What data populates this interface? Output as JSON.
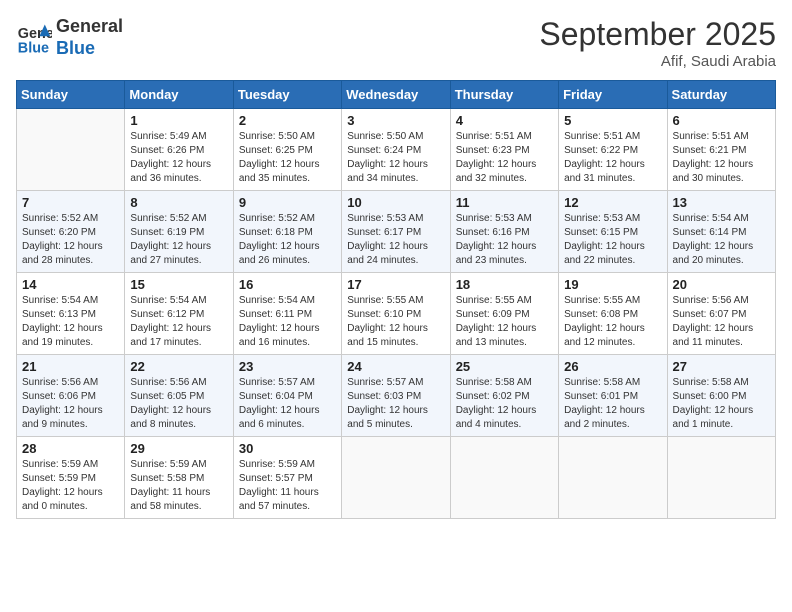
{
  "header": {
    "logo_line1": "General",
    "logo_line2": "Blue",
    "month": "September 2025",
    "location": "Afif, Saudi Arabia"
  },
  "days_of_week": [
    "Sunday",
    "Monday",
    "Tuesday",
    "Wednesday",
    "Thursday",
    "Friday",
    "Saturday"
  ],
  "weeks": [
    [
      {
        "day": "",
        "info": ""
      },
      {
        "day": "1",
        "info": "Sunrise: 5:49 AM\nSunset: 6:26 PM\nDaylight: 12 hours\nand 36 minutes."
      },
      {
        "day": "2",
        "info": "Sunrise: 5:50 AM\nSunset: 6:25 PM\nDaylight: 12 hours\nand 35 minutes."
      },
      {
        "day": "3",
        "info": "Sunrise: 5:50 AM\nSunset: 6:24 PM\nDaylight: 12 hours\nand 34 minutes."
      },
      {
        "day": "4",
        "info": "Sunrise: 5:51 AM\nSunset: 6:23 PM\nDaylight: 12 hours\nand 32 minutes."
      },
      {
        "day": "5",
        "info": "Sunrise: 5:51 AM\nSunset: 6:22 PM\nDaylight: 12 hours\nand 31 minutes."
      },
      {
        "day": "6",
        "info": "Sunrise: 5:51 AM\nSunset: 6:21 PM\nDaylight: 12 hours\nand 30 minutes."
      }
    ],
    [
      {
        "day": "7",
        "info": "Sunrise: 5:52 AM\nSunset: 6:20 PM\nDaylight: 12 hours\nand 28 minutes."
      },
      {
        "day": "8",
        "info": "Sunrise: 5:52 AM\nSunset: 6:19 PM\nDaylight: 12 hours\nand 27 minutes."
      },
      {
        "day": "9",
        "info": "Sunrise: 5:52 AM\nSunset: 6:18 PM\nDaylight: 12 hours\nand 26 minutes."
      },
      {
        "day": "10",
        "info": "Sunrise: 5:53 AM\nSunset: 6:17 PM\nDaylight: 12 hours\nand 24 minutes."
      },
      {
        "day": "11",
        "info": "Sunrise: 5:53 AM\nSunset: 6:16 PM\nDaylight: 12 hours\nand 23 minutes."
      },
      {
        "day": "12",
        "info": "Sunrise: 5:53 AM\nSunset: 6:15 PM\nDaylight: 12 hours\nand 22 minutes."
      },
      {
        "day": "13",
        "info": "Sunrise: 5:54 AM\nSunset: 6:14 PM\nDaylight: 12 hours\nand 20 minutes."
      }
    ],
    [
      {
        "day": "14",
        "info": "Sunrise: 5:54 AM\nSunset: 6:13 PM\nDaylight: 12 hours\nand 19 minutes."
      },
      {
        "day": "15",
        "info": "Sunrise: 5:54 AM\nSunset: 6:12 PM\nDaylight: 12 hours\nand 17 minutes."
      },
      {
        "day": "16",
        "info": "Sunrise: 5:54 AM\nSunset: 6:11 PM\nDaylight: 12 hours\nand 16 minutes."
      },
      {
        "day": "17",
        "info": "Sunrise: 5:55 AM\nSunset: 6:10 PM\nDaylight: 12 hours\nand 15 minutes."
      },
      {
        "day": "18",
        "info": "Sunrise: 5:55 AM\nSunset: 6:09 PM\nDaylight: 12 hours\nand 13 minutes."
      },
      {
        "day": "19",
        "info": "Sunrise: 5:55 AM\nSunset: 6:08 PM\nDaylight: 12 hours\nand 12 minutes."
      },
      {
        "day": "20",
        "info": "Sunrise: 5:56 AM\nSunset: 6:07 PM\nDaylight: 12 hours\nand 11 minutes."
      }
    ],
    [
      {
        "day": "21",
        "info": "Sunrise: 5:56 AM\nSunset: 6:06 PM\nDaylight: 12 hours\nand 9 minutes."
      },
      {
        "day": "22",
        "info": "Sunrise: 5:56 AM\nSunset: 6:05 PM\nDaylight: 12 hours\nand 8 minutes."
      },
      {
        "day": "23",
        "info": "Sunrise: 5:57 AM\nSunset: 6:04 PM\nDaylight: 12 hours\nand 6 minutes."
      },
      {
        "day": "24",
        "info": "Sunrise: 5:57 AM\nSunset: 6:03 PM\nDaylight: 12 hours\nand 5 minutes."
      },
      {
        "day": "25",
        "info": "Sunrise: 5:58 AM\nSunset: 6:02 PM\nDaylight: 12 hours\nand 4 minutes."
      },
      {
        "day": "26",
        "info": "Sunrise: 5:58 AM\nSunset: 6:01 PM\nDaylight: 12 hours\nand 2 minutes."
      },
      {
        "day": "27",
        "info": "Sunrise: 5:58 AM\nSunset: 6:00 PM\nDaylight: 12 hours\nand 1 minute."
      }
    ],
    [
      {
        "day": "28",
        "info": "Sunrise: 5:59 AM\nSunset: 5:59 PM\nDaylight: 12 hours\nand 0 minutes."
      },
      {
        "day": "29",
        "info": "Sunrise: 5:59 AM\nSunset: 5:58 PM\nDaylight: 11 hours\nand 58 minutes."
      },
      {
        "day": "30",
        "info": "Sunrise: 5:59 AM\nSunset: 5:57 PM\nDaylight: 11 hours\nand 57 minutes."
      },
      {
        "day": "",
        "info": ""
      },
      {
        "day": "",
        "info": ""
      },
      {
        "day": "",
        "info": ""
      },
      {
        "day": "",
        "info": ""
      }
    ]
  ]
}
